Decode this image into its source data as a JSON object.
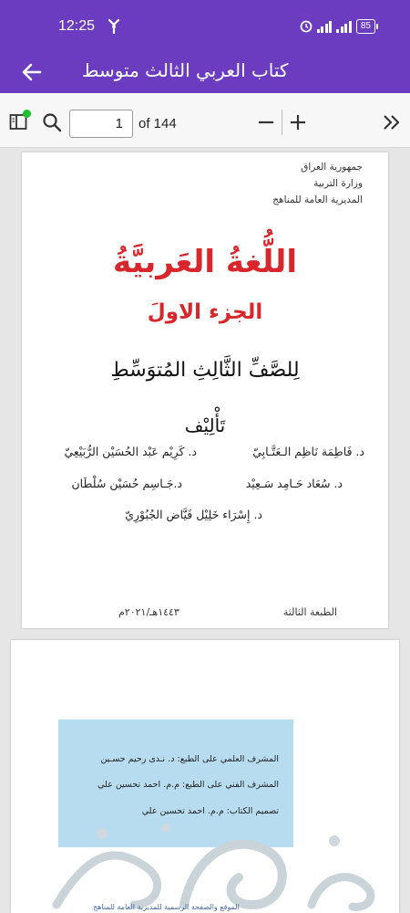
{
  "status_bar": {
    "time": "12:25",
    "battery": "85"
  },
  "app_bar": {
    "title": "كتاب العربي الثالث متوسط"
  },
  "toolbar": {
    "page_input_value": "1",
    "page_count": "of 144"
  },
  "page1": {
    "ministry_lines": [
      "جمهورية العراق",
      "وزارة التربية",
      "المديرية العامة للمناهج"
    ],
    "title": "اللُّغةُ العَربيَّةُ",
    "part": "الجزء الاولَ",
    "grade": "لِلصَّفِّ الثَّالِثِ المُتوَسِّطِ",
    "authorship_label": "تَأْلِيْف",
    "authors": [
      "د. فَاطِمَة نَاظِم الـعَتَّـابِيّ",
      "د. كَرِيْم عَبْد الحُسَيْن الرُّبَيْعِيّ",
      "د. سُعَاد حَـامِد سَـعِيْد",
      "د.جَـاسِم حُسَيْن سُلْطَان",
      "د. إِسْرَاء خَلِيْل فَيَّاض الجُبُوْرِيّ"
    ],
    "edition": "الطبعة الثالثة",
    "year": "١٤٤٣هـ/٢٠٢١م"
  },
  "page2": {
    "credits": [
      "المشرف العلمي على الطبع: د. نـدى رحيم حسـين",
      "المشرف الفني على الطبع: م.م. احمد تحسين علي",
      "تصميم الكتاب: م.م. احمد تحسين علي"
    ],
    "footer": "الموقع والصفحة الرسمية للمديرية العامة للمناهج"
  },
  "colors": {
    "accent": "#6b3cbf",
    "title_red": "#d7262c",
    "credits_bg": "#b7dcef"
  },
  "icons": [
    "fan-icon",
    "alarm-icon",
    "signal-icon",
    "back-arrow-icon",
    "sidebar-icon",
    "search-icon",
    "minus-icon",
    "plus-icon",
    "double-chevron-icon"
  ]
}
